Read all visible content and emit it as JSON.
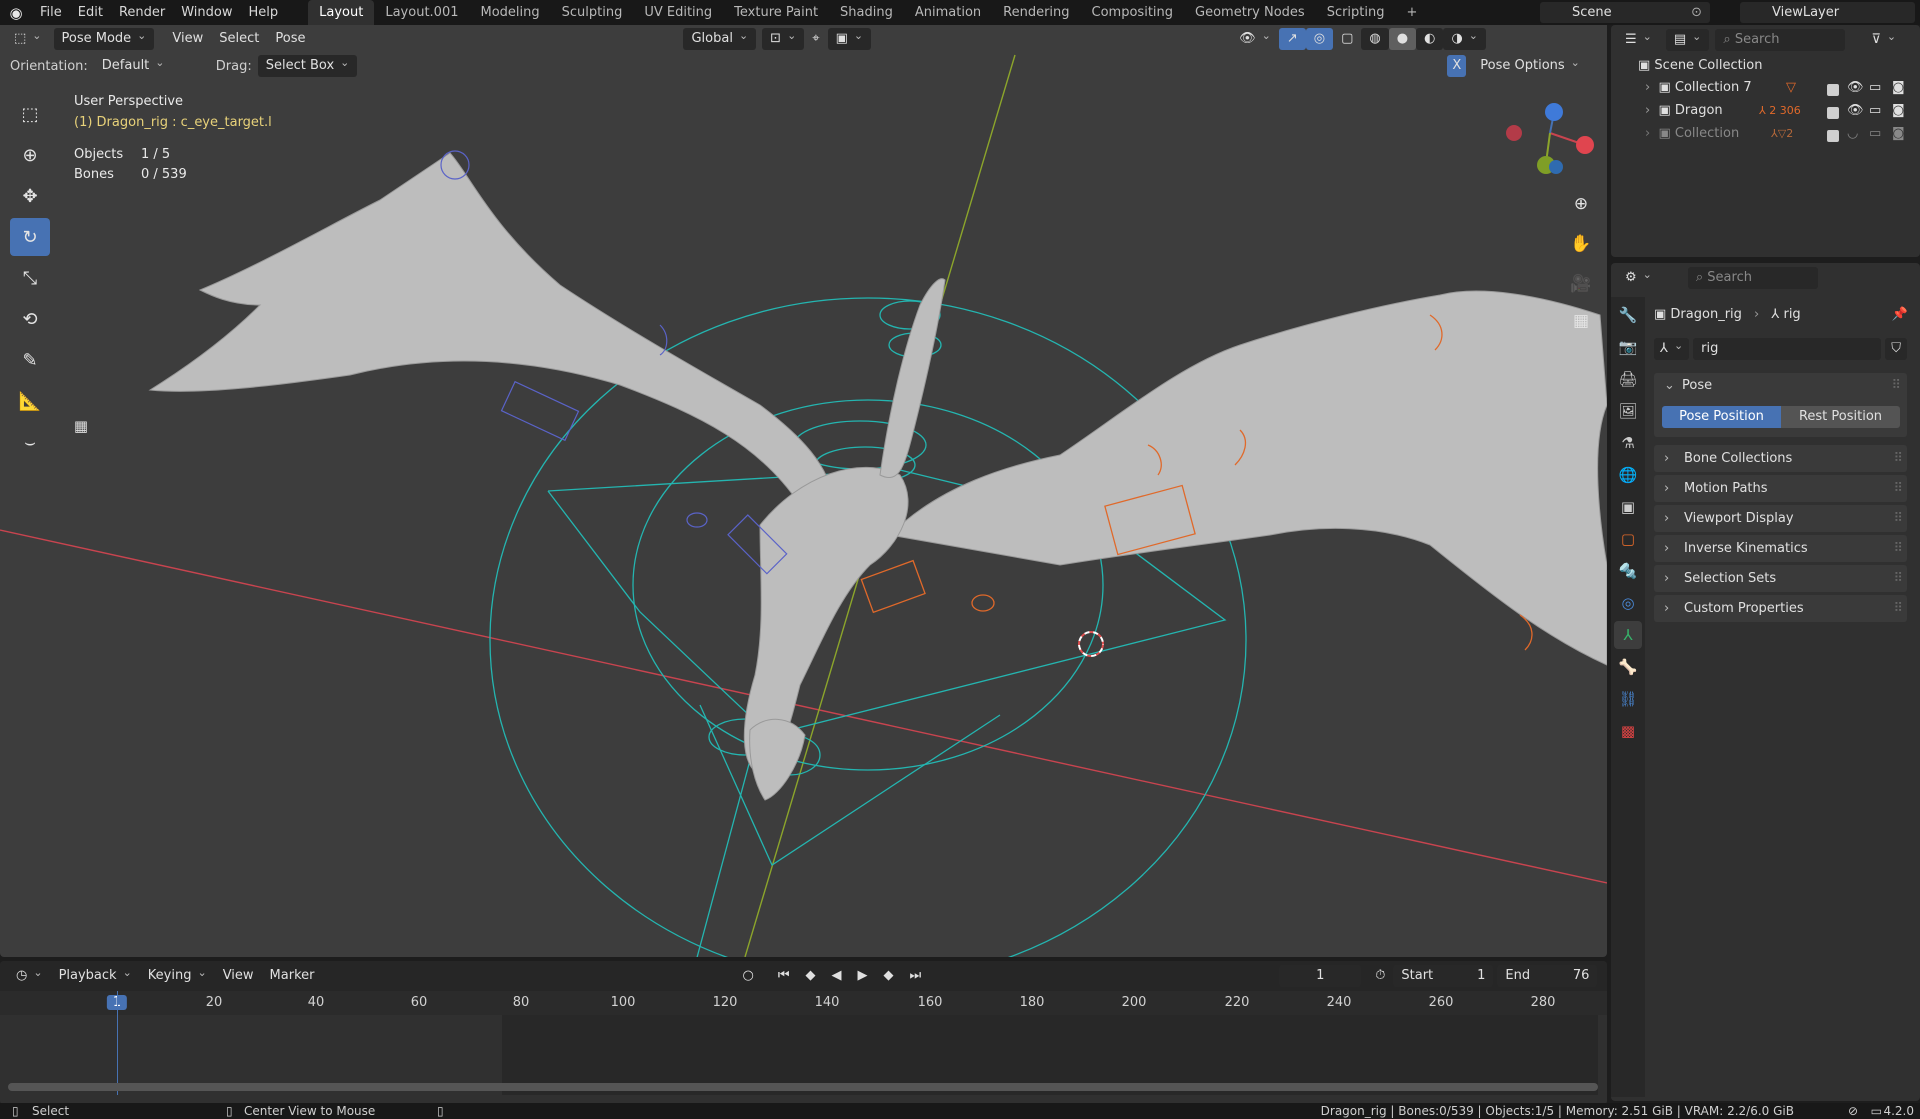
{
  "topbar": {
    "menus": [
      "File",
      "Edit",
      "Render",
      "Window",
      "Help"
    ],
    "tabs": [
      "Layout",
      "Layout.001",
      "Modeling",
      "Sculpting",
      "UV Editing",
      "Texture Paint",
      "Shading",
      "Animation",
      "Rendering",
      "Compositing",
      "Geometry Nodes",
      "Scripting"
    ],
    "active_tab": "Layout",
    "scene": "Scene",
    "view_layer": "ViewLayer"
  },
  "viewport": {
    "mode": "Pose Mode",
    "menus": [
      "View",
      "Select",
      "Pose"
    ],
    "transform_orientation": "Global",
    "orientation_label": "Orientation:",
    "orientation_value": "Default",
    "drag_label": "Drag:",
    "drag_value": "Select Box",
    "pose_options": "Pose Options",
    "x_mirror": "X",
    "overlay": {
      "view_name": "User Perspective",
      "active": "(1) Dragon_rig : c_eye_target.l",
      "objects_label": "Objects",
      "objects_value": "1 / 5",
      "bones_label": "Bones",
      "bones_value": "0 / 539"
    },
    "gizmo": {
      "z": "Z",
      "y": "Y",
      "x": "X"
    },
    "colors": {
      "bg": "#3d3d3d",
      "x_axis": "#c8444f",
      "y_axis": "#8ca52b",
      "teal": "#24b5b0",
      "orange": "#e0692a",
      "mesh": "#c4c4c4"
    }
  },
  "timeline": {
    "menus": [
      "Playback",
      "Keying",
      "View",
      "Marker"
    ],
    "current_frame": "1",
    "start_label": "Start",
    "start": "1",
    "end_label": "End",
    "end": "76",
    "ticks": [
      "1",
      "20",
      "40",
      "60",
      "80",
      "100",
      "120",
      "140",
      "160",
      "180",
      "200",
      "220",
      "240",
      "260",
      "280"
    ]
  },
  "outliner": {
    "search_placeholder": "Search",
    "root": "Scene Collection",
    "items": [
      {
        "name": "Collection 7"
      },
      {
        "name": "Dragon",
        "badge": "2 306"
      },
      {
        "name": "Collection",
        "badge": "2"
      }
    ]
  },
  "properties": {
    "search_placeholder": "Search",
    "breadcrumb_object": "Dragon_rig",
    "breadcrumb_data": "rig",
    "datablock_name": "rig",
    "panel": "Pose",
    "pose_position": "Pose Position",
    "rest_position": "Rest Position",
    "subpanels": [
      "Bone Collections",
      "Motion Paths",
      "Viewport Display",
      "Inverse Kinematics",
      "Selection Sets",
      "Custom Properties"
    ]
  },
  "statusbar": {
    "left_action": "Select",
    "middle_action": "Center View to Mouse",
    "right": "Dragon_rig | Bones:0/539 | Objects:1/5 | Memory: 2.51 GiB | VRAM: 2.2/6.0 GiB",
    "version": "4.2.0"
  }
}
